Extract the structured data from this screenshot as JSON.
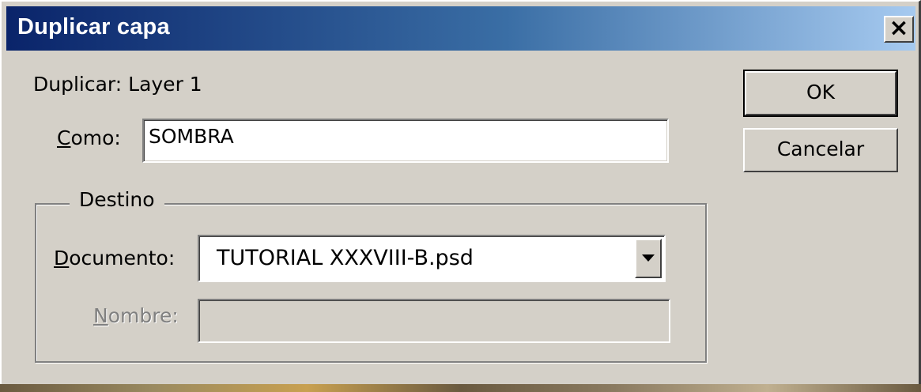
{
  "window": {
    "title": "Duplicar capa",
    "close_glyph": "×"
  },
  "source": {
    "label": "Duplicar:",
    "value": "Layer 1"
  },
  "como": {
    "label_mnemonic": "C",
    "label_rest": "omo:",
    "value": "SOMBRA"
  },
  "destino": {
    "legend": "Destino",
    "documento": {
      "label_mnemonic": "D",
      "label_rest": "ocumento:",
      "selected": "TUTORIAL XXXVIII-B.psd"
    },
    "nombre": {
      "label_mnemonic": "N",
      "label_rest": "ombre:",
      "value": ""
    }
  },
  "buttons": {
    "ok": "OK",
    "cancel": "Cancelar"
  },
  "icons": {
    "close": "close-icon",
    "dropdown": "chevron-down-icon"
  }
}
